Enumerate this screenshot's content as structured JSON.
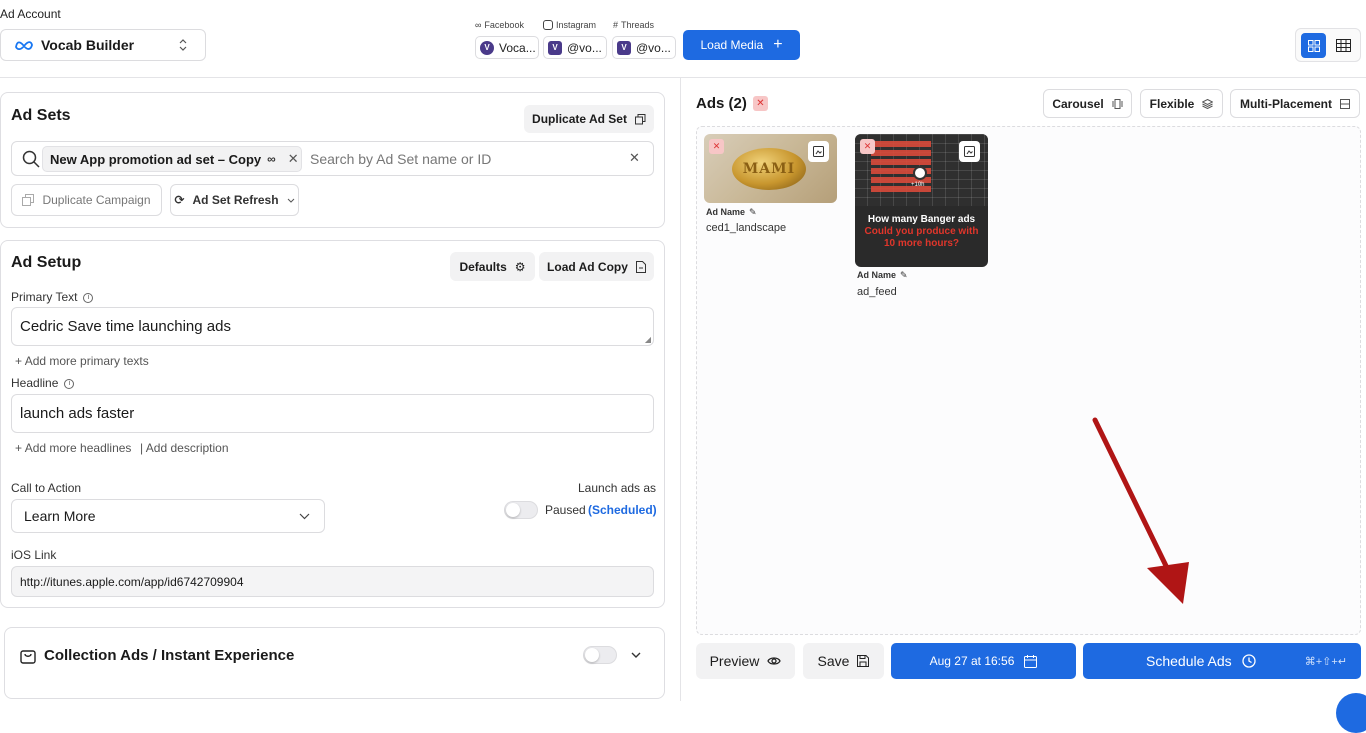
{
  "header": {
    "ad_account_label": "Ad Account",
    "ad_account_value": "Vocab Builder",
    "socials": [
      {
        "label": "Facebook",
        "account": "Voca..."
      },
      {
        "label": "Instagram",
        "account": "@vo..."
      },
      {
        "label": "Threads",
        "account": "@vo..."
      }
    ],
    "load_media": "Load Media"
  },
  "ad_sets": {
    "title": "Ad Sets",
    "duplicate_ad_set": "Duplicate Ad Set",
    "selected_chip": "New App promotion ad set – Copy",
    "search_placeholder": "Search by Ad Set name or ID",
    "duplicate_campaign": "Duplicate Campaign",
    "ad_set_refresh": "Ad Set Refresh"
  },
  "ad_setup": {
    "title": "Ad Setup",
    "defaults": "Defaults",
    "load_ad_copy": "Load Ad Copy",
    "primary_text_label": "Primary Text",
    "primary_text_value": "Cedric Save time launching ads",
    "add_primary": "Add more primary texts",
    "headline_label": "Headline",
    "headline_value": "launch ads faster",
    "add_headlines": "Add more headlines",
    "add_description": "| Add description",
    "cta_label": "Call to Action",
    "cta_value": "Learn More",
    "launch_as_label": "Launch ads as",
    "paused": "Paused",
    "scheduled": "(Scheduled)",
    "ios_link_label": "iOS Link",
    "ios_link_value": "http://itunes.apple.com/app/id6742709904"
  },
  "collection": {
    "title": "Collection Ads / Instant Experience"
  },
  "ads_panel": {
    "title": "Ads (2)",
    "carousel": "Carousel",
    "flexible": "Flexible",
    "multi_placement": "Multi-Placement",
    "items": [
      {
        "name_label": "Ad Name",
        "name": "ced1_landscape",
        "thumb_text": "MAMI"
      },
      {
        "name_label": "Ad Name",
        "name": "ad_feed",
        "thumb_line1": "How many Banger ads",
        "thumb_line2": "Could you produce with",
        "thumb_line3": "10 more hours?",
        "thumb_badge": "+10h"
      }
    ]
  },
  "footer": {
    "preview": "Preview",
    "save": "Save",
    "date": "Aug 27 at 16:56",
    "schedule": "Schedule Ads",
    "shortcut": "⌘+⇧+↵"
  },
  "colors": {
    "primary": "#1e6ae1",
    "annotation_arrow": "#b01515"
  }
}
